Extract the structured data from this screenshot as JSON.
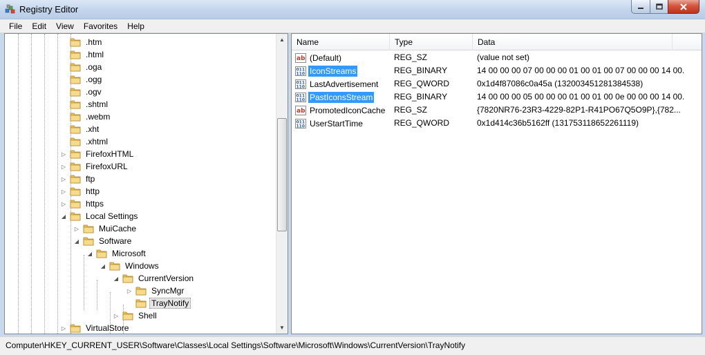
{
  "window": {
    "title": "Registry Editor"
  },
  "menu": [
    "File",
    "Edit",
    "View",
    "Favorites",
    "Help"
  ],
  "tree": {
    "items": [
      {
        "label": ".htm",
        "depth": 5,
        "expander": "none"
      },
      {
        "label": ".html",
        "depth": 5,
        "expander": "none"
      },
      {
        "label": ".oga",
        "depth": 5,
        "expander": "none"
      },
      {
        "label": ".ogg",
        "depth": 5,
        "expander": "none"
      },
      {
        "label": ".ogv",
        "depth": 5,
        "expander": "none"
      },
      {
        "label": ".shtml",
        "depth": 5,
        "expander": "none"
      },
      {
        "label": ".webm",
        "depth": 5,
        "expander": "none"
      },
      {
        "label": ".xht",
        "depth": 5,
        "expander": "none"
      },
      {
        "label": ".xhtml",
        "depth": 5,
        "expander": "none"
      },
      {
        "label": "FirefoxHTML",
        "depth": 5,
        "expander": "collapsed"
      },
      {
        "label": "FirefoxURL",
        "depth": 5,
        "expander": "collapsed"
      },
      {
        "label": "ftp",
        "depth": 5,
        "expander": "collapsed"
      },
      {
        "label": "http",
        "depth": 5,
        "expander": "collapsed"
      },
      {
        "label": "https",
        "depth": 5,
        "expander": "collapsed"
      },
      {
        "label": "Local Settings",
        "depth": 5,
        "expander": "expanded"
      },
      {
        "label": "MuiCache",
        "depth": 6,
        "expander": "collapsed"
      },
      {
        "label": "Software",
        "depth": 6,
        "expander": "expanded"
      },
      {
        "label": "Microsoft",
        "depth": 7,
        "expander": "expanded"
      },
      {
        "label": "Windows",
        "depth": 8,
        "expander": "expanded"
      },
      {
        "label": "CurrentVersion",
        "depth": 9,
        "expander": "expanded"
      },
      {
        "label": "SyncMgr",
        "depth": 10,
        "expander": "collapsed"
      },
      {
        "label": "TrayNotify",
        "depth": 10,
        "expander": "none",
        "selected": true
      },
      {
        "label": "Shell",
        "depth": 9,
        "expander": "collapsed"
      },
      {
        "label": "VirtualStore",
        "depth": 5,
        "expander": "collapsed"
      }
    ]
  },
  "values": {
    "columns": [
      "Name",
      "Type",
      "Data"
    ],
    "rows": [
      {
        "name": "(Default)",
        "type": "REG_SZ",
        "data": "(value not set)",
        "icon": "string-value-icon",
        "selected": false
      },
      {
        "name": "IconStreams",
        "type": "REG_BINARY",
        "data": "14 00 00 00 07 00 00 00 01 00 01 00 07 00 00 00 14 00...",
        "icon": "binary-value-icon",
        "selected": true
      },
      {
        "name": "LastAdvertisement",
        "type": "REG_QWORD",
        "data": "0x1d4f87086c0a45a (132003451281384538)",
        "icon": "binary-value-icon",
        "selected": false
      },
      {
        "name": "PastIconsStream",
        "type": "REG_BINARY",
        "data": "14 00 00 00 05 00 00 00 01 00 01 00 0e 00 00 00 14 00...",
        "icon": "binary-value-icon",
        "selected": true
      },
      {
        "name": "PromotedIconCache",
        "type": "REG_SZ",
        "data": "{7820NR76-23R3-4229-82P1-R41PO67Q5O9P},{782...",
        "icon": "string-value-icon",
        "selected": false
      },
      {
        "name": "UserStartTime",
        "type": "REG_QWORD",
        "data": "0x1d414c36b5162ff (131753118652261119)",
        "icon": "binary-value-icon",
        "selected": false
      }
    ]
  },
  "status": {
    "path": "Computer\\HKEY_CURRENT_USER\\Software\\Classes\\Local Settings\\Software\\Microsoft\\Windows\\CurrentVersion\\TrayNotify"
  },
  "colors": {
    "selection": "#3399ff",
    "folder": "#e8c15a",
    "window_frame": "#c9d9ec"
  }
}
